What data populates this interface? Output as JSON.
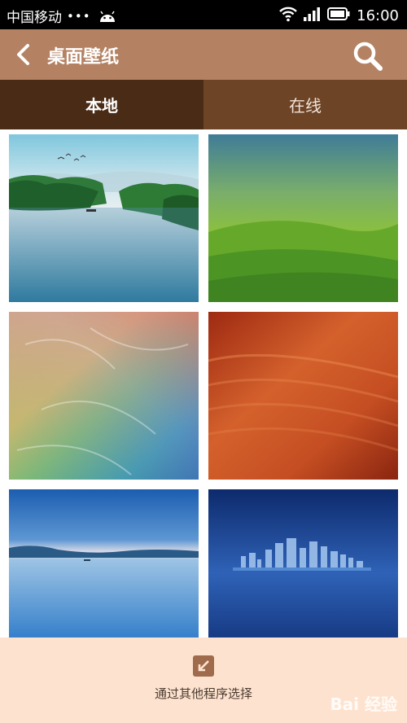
{
  "status_bar": {
    "carrier": "中国移动",
    "dots": "•••",
    "time": "16:00"
  },
  "header": {
    "title": "桌面壁纸",
    "back_icon": "back-arrow-icon",
    "search_icon": "search-icon"
  },
  "tabs": [
    {
      "label": "本地",
      "active": true
    },
    {
      "label": "在线",
      "active": false
    }
  ],
  "wallpapers": [
    {
      "name": "river-landscape"
    },
    {
      "name": "green-hills"
    },
    {
      "name": "colorful-leaves"
    },
    {
      "name": "orange-waves"
    },
    {
      "name": "blue-lake"
    },
    {
      "name": "night-city"
    }
  ],
  "bottom_bar": {
    "label": "通过其他程序选择",
    "icon": "import-icon",
    "watermark": "Bai 经验"
  },
  "colors": {
    "header": "#b48263",
    "tab_active": "#4a2b16",
    "tab_inactive": "#6e4426",
    "bottom_bar": "#fde3cf"
  }
}
